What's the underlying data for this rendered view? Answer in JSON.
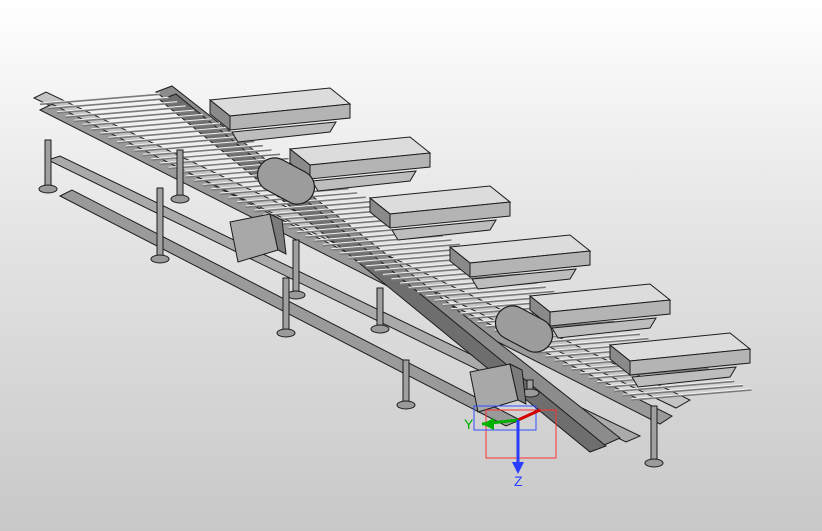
{
  "viewport": {
    "background_top": "#ffffff",
    "background_bottom": "#c8c8c8"
  },
  "model": {
    "roller_modules": 6,
    "rail_color": "#4a4a4a",
    "face_light": "#dcdcdc",
    "face_mid": "#b4b4b4",
    "face_dark": "#8a8a8a",
    "roller_color": "#f2f2f2",
    "edge_color": "#1c1c1c"
  },
  "triad": {
    "y_label": "Y",
    "z_label": "Z",
    "x_color": "#d40000",
    "y_color": "#00b000",
    "z_color": "#2a3cff"
  }
}
